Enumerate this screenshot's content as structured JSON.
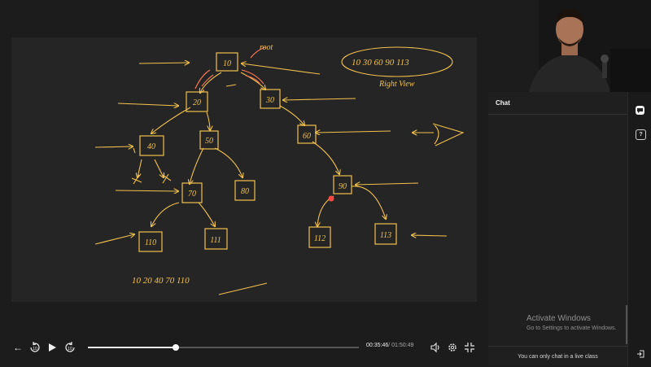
{
  "player": {
    "current_time": "00:35:46",
    "duration": "/ 01:50:49",
    "progress": 0.323,
    "rewind_seconds": "10",
    "forward_seconds": "10"
  },
  "whiteboard": {
    "root_label": "root",
    "nodes": [
      "10",
      "20",
      "30",
      "40",
      "50",
      "60",
      "70",
      "80",
      "90",
      "110",
      "111",
      "112",
      "113"
    ],
    "right_view_sequence": "10 30 60 90 113",
    "right_view_label": "Right View",
    "bottom_sequence": "10 20 40 70 110"
  },
  "sidebar": {
    "chat_title": "Chat",
    "chat_note": "You can only chat in a live class",
    "watermark_title": "Activate Windows",
    "watermark_subtitle": "Go to Settings to activate Windows."
  },
  "colors": {
    "ink": "#f2c14e",
    "accent": "#ff7a59",
    "background": "#1b1b1b",
    "canvas": "#252525"
  }
}
